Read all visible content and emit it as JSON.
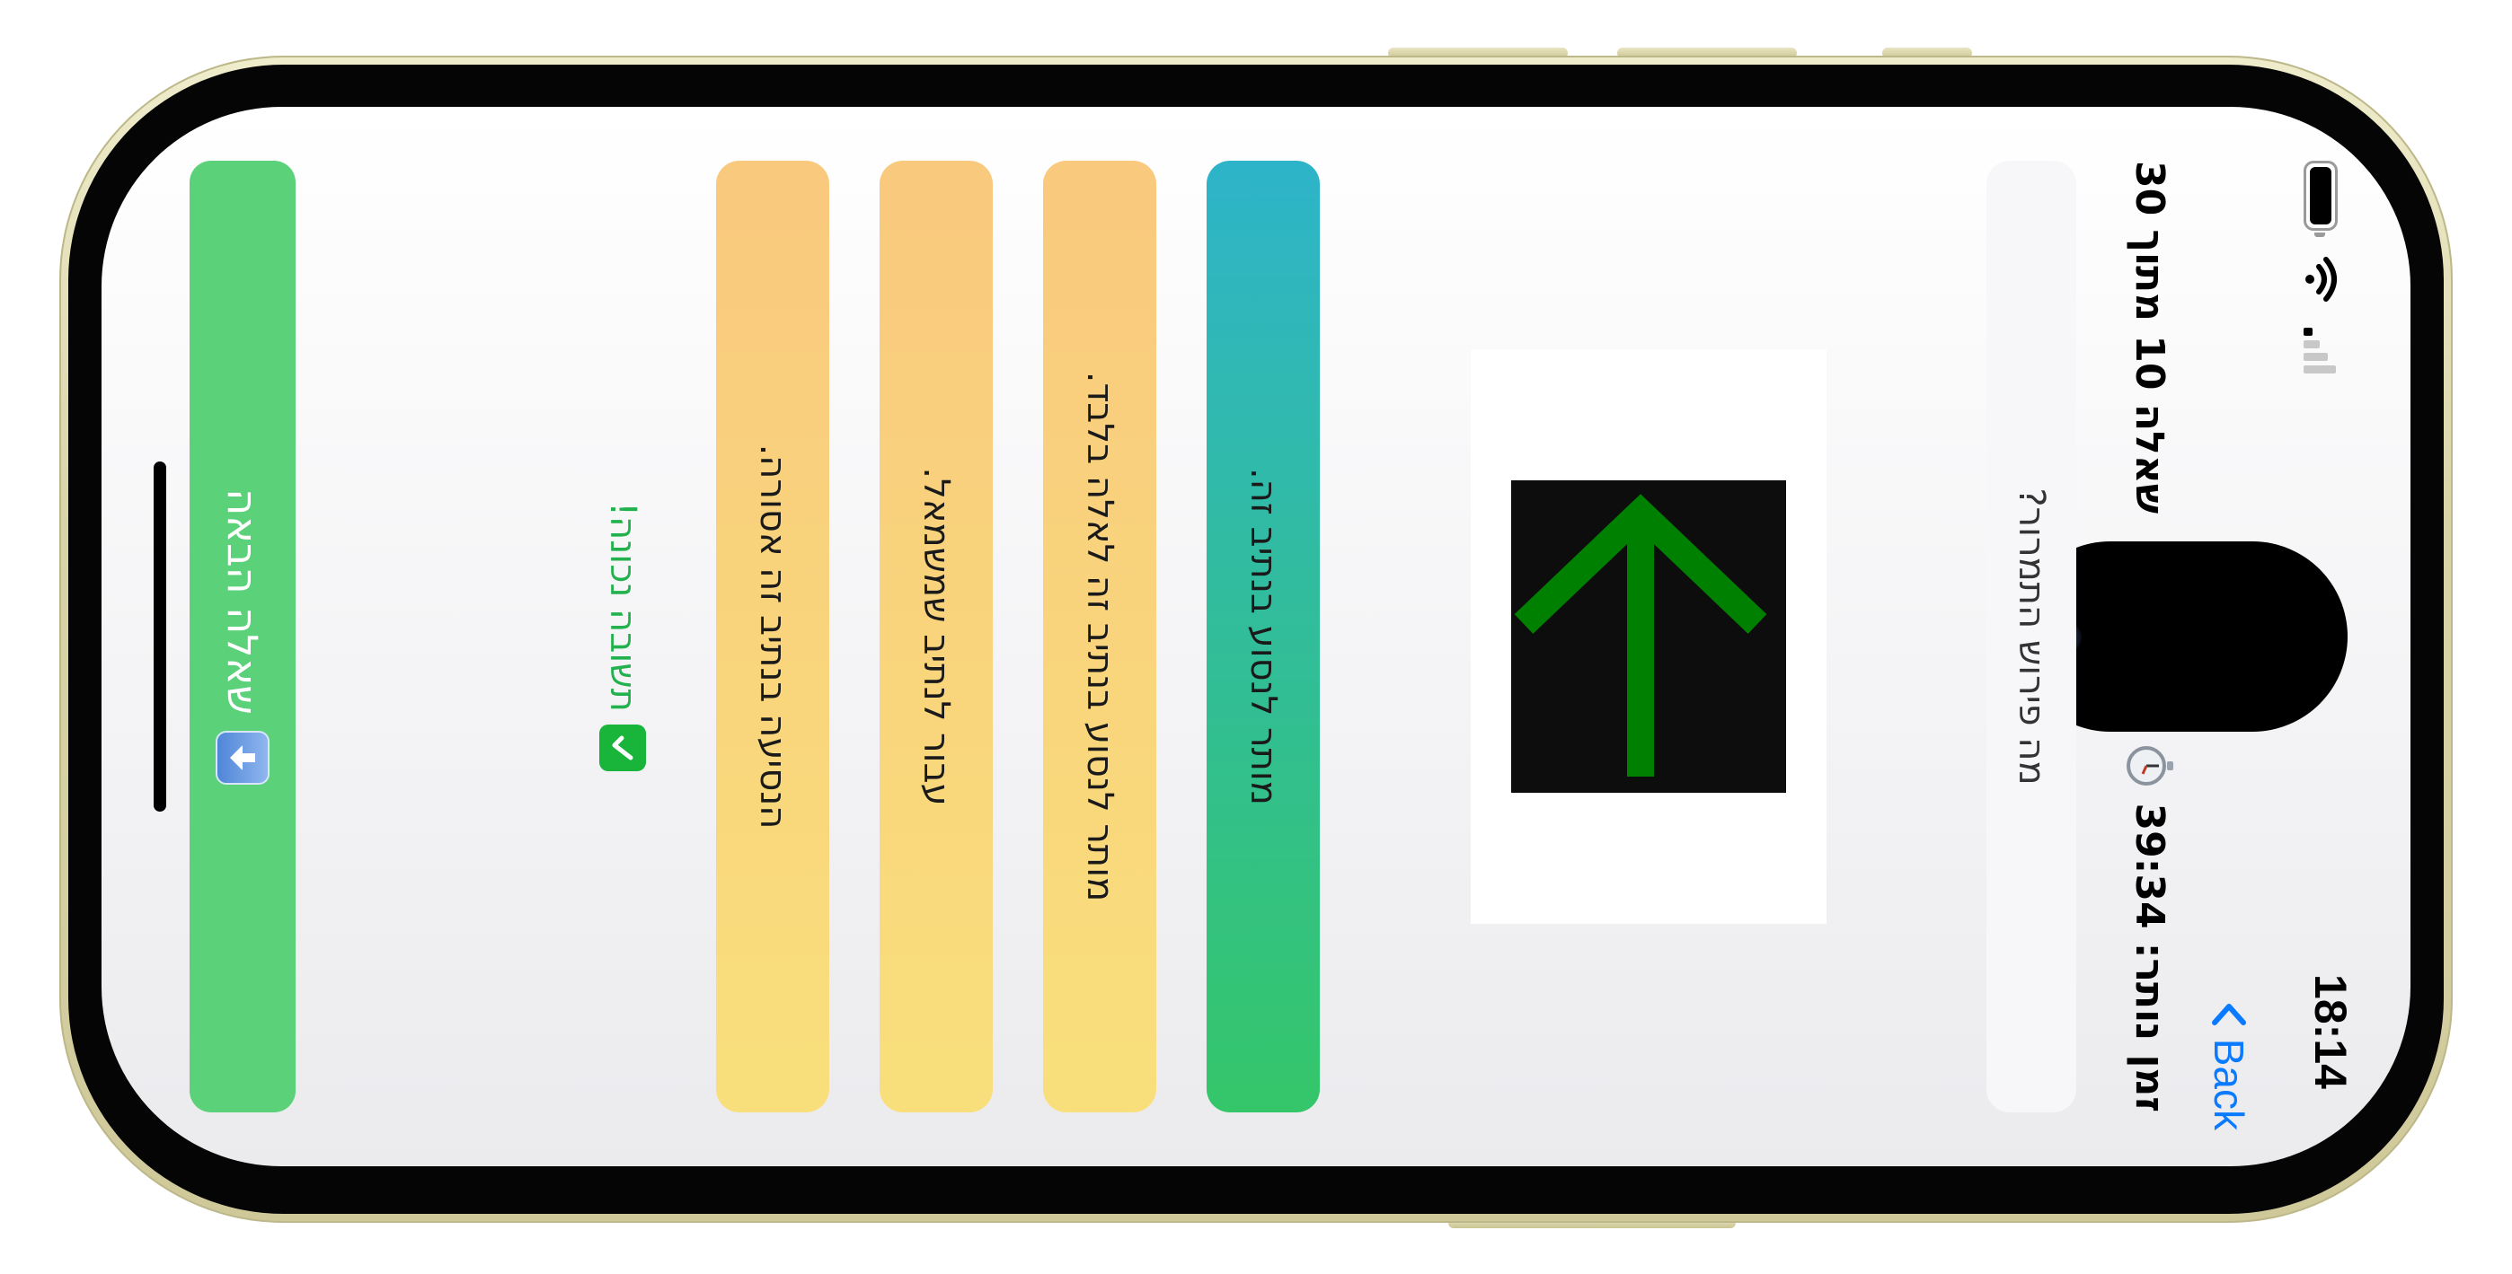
{
  "status_bar": {
    "time": "18:14"
  },
  "nav": {
    "back_label": "Back"
  },
  "quiz": {
    "question_counter": "שאלה 10 מתוך 30",
    "timer_text": "זמן נותר: 39:34",
    "explain_label": "מה פירוש התמרור?",
    "sign": {
      "description": "green arrow pointing left on black panel",
      "arrow_color": "#008000",
      "panel_color": "#0d0d0d"
    },
    "answers": [
      {
        "text": "מותר לנסוע בנתיב זה.",
        "state": "correct"
      },
      {
        "text": "מותר לנסוע בנתיב זה לאלה בלבד.",
        "state": "normal"
      },
      {
        "text": "עבור לנתיב שמשמאל.",
        "state": "normal"
      },
      {
        "text": "הנסיעה בנתיב זה אסורה.",
        "state": "normal"
      }
    ],
    "feedback_text": "תשובה נכונה!",
    "next_label": "שאלה הבאה"
  },
  "colors": {
    "correct_start": "#35c66a",
    "correct_end": "#2eb4c9",
    "answer_start": "#f9df7c",
    "answer_end": "#f9c97d",
    "next_button": "#5bd27a",
    "feedback": "#22b14c",
    "back_link": "#0a7aff"
  }
}
